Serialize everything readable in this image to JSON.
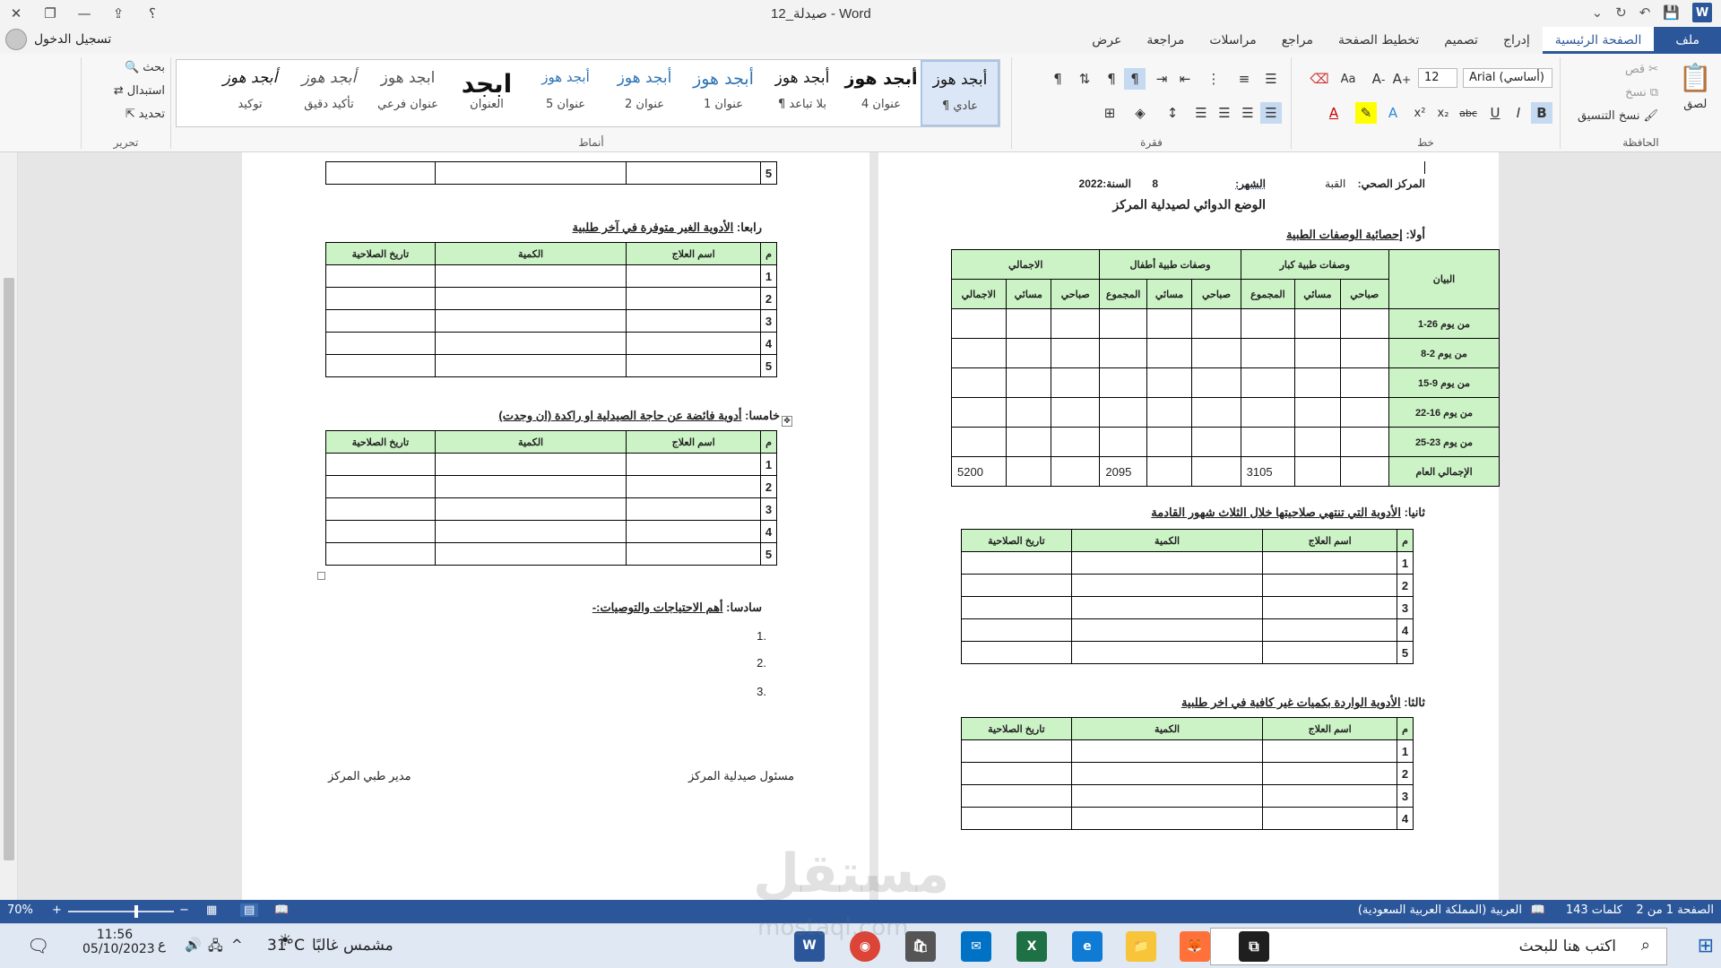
{
  "window": {
    "title": "صيدلة_12 - Word",
    "help": "؟"
  },
  "account": {
    "signin": "تسجيل الدخول"
  },
  "tabs": [
    "ملف",
    "الصفحة الرئيسية",
    "إدراج",
    "تصميم",
    "تخطيط الصفحة",
    "مراجع",
    "مراسلات",
    "مراجعة",
    "عرض"
  ],
  "clipboard": {
    "paste": "لصق",
    "cut": "قص",
    "copy": "نسخ",
    "format_painter": "نسخ التنسيق",
    "group": "الحافظة"
  },
  "font": {
    "name": "Arial (أساسي)",
    "size": "12",
    "group": "خط",
    "bold": "B",
    "italic": "I",
    "underline": "U",
    "strike": "abc",
    "sub": "x₂",
    "sup": "x²",
    "change_case": "Aa"
  },
  "paragraph": {
    "group": "فقرة"
  },
  "styles": {
    "group": "أنماط",
    "items": [
      {
        "preview": "أبجد هوز",
        "name": "¶ عادي"
      },
      {
        "preview": "أبجد هوز",
        "name": "عنوان 4"
      },
      {
        "preview": "أبجد هوز",
        "name": "¶ بلا تباعد"
      },
      {
        "preview": "أبجد هوز",
        "name": "عنوان 1"
      },
      {
        "preview": "أبجد هوز",
        "name": "عنوان 2"
      },
      {
        "preview": "أبجد هوز",
        "name": "عنوان 5"
      },
      {
        "preview": "ابجد",
        "name": "العنوان"
      },
      {
        "preview": "ابجد هوز",
        "name": "عنوان فرعي"
      },
      {
        "preview": "أبجد هوز",
        "name": "تأكيد دقيق"
      },
      {
        "preview": "أبجد هوز",
        "name": "توكيد"
      }
    ]
  },
  "editing": {
    "find": "بحث",
    "replace": "استبدال",
    "select": "تحديد",
    "group": "تحرير"
  },
  "page1": {
    "header_center": "المركز الصحي:",
    "header_center_val": "القبة",
    "header_month": "الشهر:",
    "header_month_val": "8",
    "header_year": "السنة:2022",
    "title": "الوضع الدوائي لصيدلية المركز",
    "sec1_prefix": "أولا:",
    "sec1": "إحصائية الوصفات الطبية",
    "stats_headers": {
      "item": "البيان",
      "adults": "وصفات طبية كبار",
      "children": "وصفات طبية أطفال",
      "total": "الاجمالي",
      "morning": "صباحي",
      "evening": "مسائي",
      "sum": "المجموع",
      "grand": "الاجمالي"
    },
    "stats_rows": [
      "من يوم 26-1",
      "من يوم 2-8",
      "من يوم 9-15",
      "من يوم 16-22",
      "من يوم 23-25",
      "الإجمالي العام"
    ],
    "stats_totals": {
      "adults_sum": "3105",
      "children_sum": "2095",
      "grand_total": "5200"
    },
    "sec2_prefix": "ثانيا:",
    "sec2": "الأدوية التي تنتهي صلاحيتها خلال الثلاث شهور القادمة",
    "sec3_prefix": "ثالثا:",
    "sec3": "الأدوية الواردة بكميات غير كافية في اخر طلبية"
  },
  "page2": {
    "sec4_prefix": "رابعا:",
    "sec4": "الأدوية الغير متوفرة في آخر طلبية",
    "sec5_prefix": "خامسا:",
    "sec5": "أدوية فائضة عن حاجة الصيدلية او راكدة (ان وجدت)",
    "sec6_prefix": "سادسا:",
    "sec6": "أهم الاحتياجات والتوصيات:-",
    "list": [
      "1.",
      "2.",
      "3."
    ],
    "sign_pharmacy": "مسئول صيدلية المركز",
    "sign_director": "مدير طبي المركز"
  },
  "table_headers": {
    "num": "م",
    "drug": "اسم العلاج",
    "qty": "الكمية",
    "expiry": "تاريخ الصلاحية"
  },
  "row_numbers": [
    "1",
    "2",
    "3",
    "4",
    "5"
  ],
  "status": {
    "page": "الصفحة 1 من 2",
    "words": "143 كلمات",
    "language": "العربية (المملكة العربية السعودية)",
    "zoom": "70%"
  },
  "taskbar": {
    "search_placeholder": "اكتب هنا للبحث",
    "weather": "مشمس غالبًا",
    "temp": "31°C",
    "time": "11:56",
    "date": "05/10/2023",
    "lang": "ع"
  },
  "watermark": {
    "brand": "مستقل",
    "url": "mostaql.com"
  },
  "colors": {
    "accent": "#2b579a",
    "header_fill": "#ccf3c6"
  }
}
